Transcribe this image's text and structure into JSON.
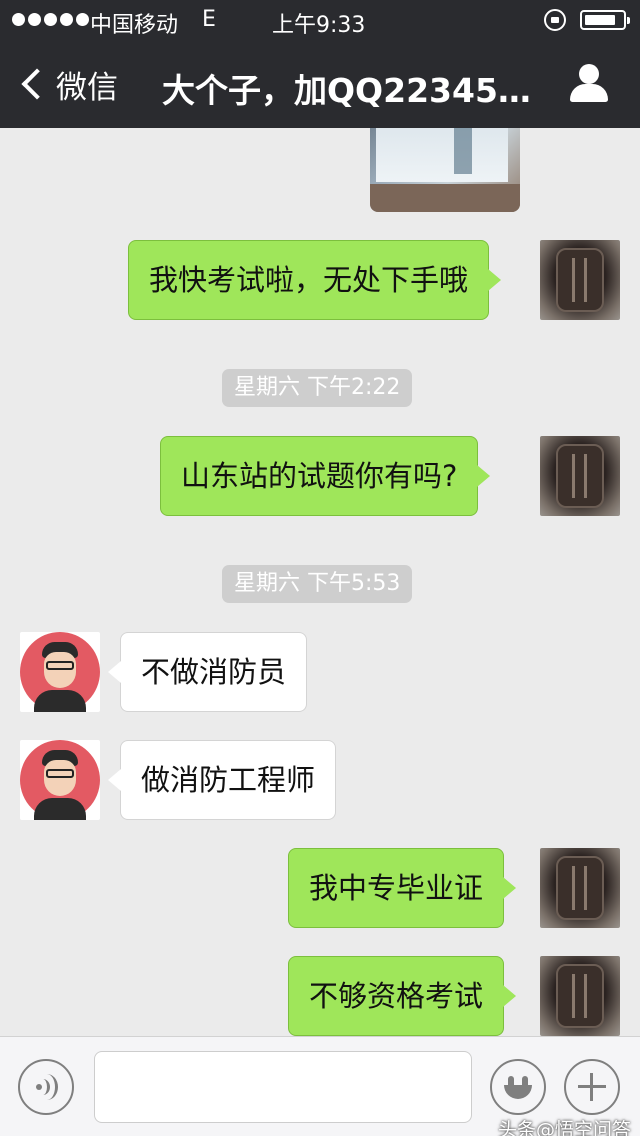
{
  "status_bar": {
    "carrier": "中国移动",
    "network": "E",
    "time": "上午9:33"
  },
  "nav": {
    "back_label": "微信",
    "title": "大个子，加QQ22345…"
  },
  "messages": [
    {
      "type": "text",
      "direction": "out",
      "text": "我快考试啦，无处下手哦"
    },
    {
      "type": "timestamp",
      "text": "星期六 下午2:22"
    },
    {
      "type": "text",
      "direction": "out",
      "text": "山东站的试题你有吗?"
    },
    {
      "type": "timestamp",
      "text": "星期六 下午5:53"
    },
    {
      "type": "text",
      "direction": "in",
      "text": "不做消防员"
    },
    {
      "type": "text",
      "direction": "in",
      "text": "做消防工程师"
    },
    {
      "type": "text",
      "direction": "out",
      "text": "我中专毕业证"
    },
    {
      "type": "text",
      "direction": "out",
      "text": "不够资格考试"
    }
  ],
  "input": {
    "value": "",
    "placeholder": ""
  },
  "watermark": "头条@悟空问答",
  "icons": [
    "chevron-left-icon",
    "person-icon",
    "lock-icon",
    "battery-icon",
    "voice-icon",
    "smile-icon",
    "plus-icon"
  ],
  "colors": {
    "bar_bg": "#2a2b2f",
    "chat_bg": "#ebebeb",
    "outgoing_bubble": "#9fe65a",
    "incoming_bubble": "#ffffff",
    "timestamp_bg": "#cecece"
  }
}
